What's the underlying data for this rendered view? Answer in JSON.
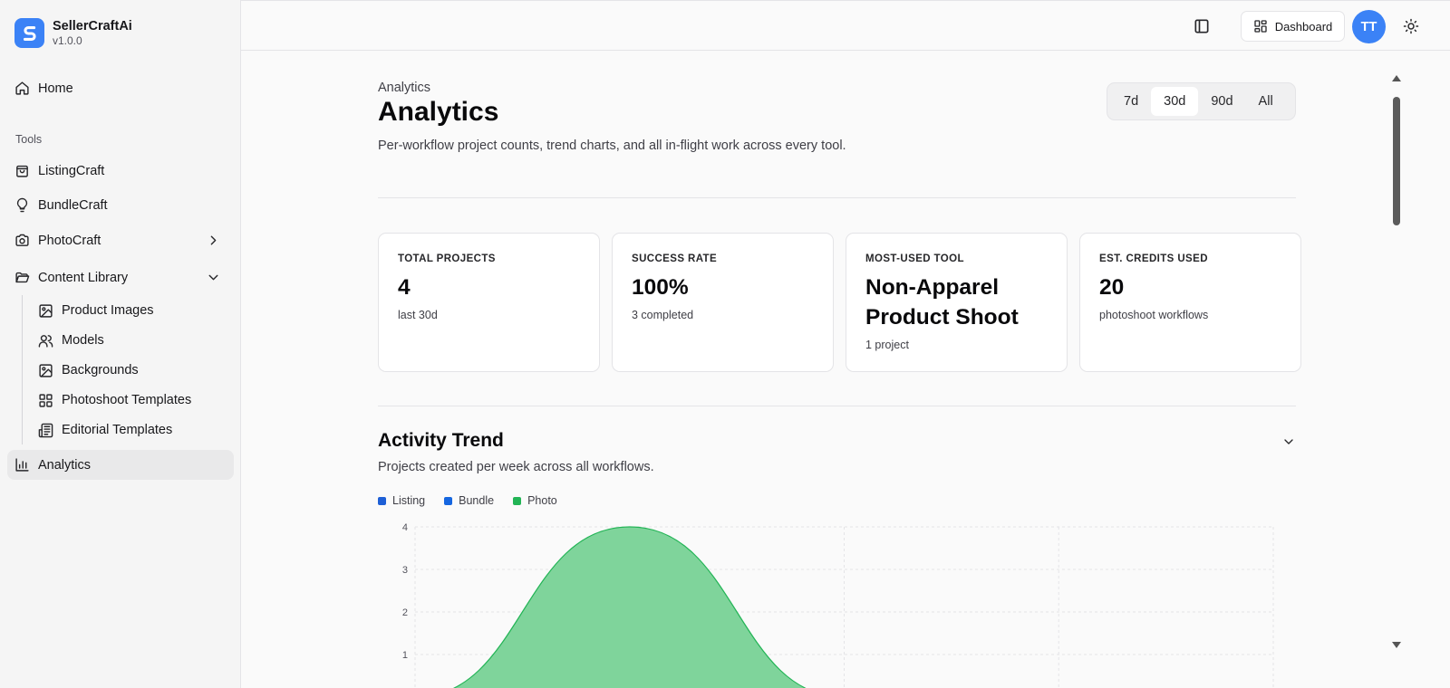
{
  "brand": {
    "name": "SellerCraftAi",
    "version": "v1.0.0"
  },
  "nav": {
    "home": "Home",
    "tools_label": "Tools",
    "listingcraft": "ListingCraft",
    "bundlecraft": "BundleCraft",
    "photocraft": "PhotoCraft",
    "content_library": "Content Library",
    "library_items": [
      "Product Images",
      "Models",
      "Backgrounds",
      "Photoshoot Templates",
      "Editorial Templates"
    ],
    "analytics": "Analytics"
  },
  "topbar": {
    "dashboard_label": "Dashboard",
    "avatar_initials": "TT"
  },
  "page": {
    "breadcrumb": "Analytics",
    "title": "Analytics",
    "description": "Per-workflow project counts, trend charts, and all in-flight work across every tool."
  },
  "range": {
    "options": [
      "7d",
      "30d",
      "90d",
      "All"
    ],
    "selected": "30d"
  },
  "cards": [
    {
      "label": "TOTAL PROJECTS",
      "value": "4",
      "sub": "last 30d"
    },
    {
      "label": "SUCCESS RATE",
      "value": "100%",
      "sub": "3 completed"
    },
    {
      "label": "MOST-USED TOOL",
      "value": "Non-Apparel Product Shoot",
      "sub": "1 project"
    },
    {
      "label": "EST. CREDITS USED",
      "value": "20",
      "sub": "photoshoot workflows"
    }
  ],
  "activity": {
    "title": "Activity Trend",
    "description": "Projects created per week across all workflows."
  },
  "colors": {
    "accent": "#3b82f6",
    "listing": "#1d5fd6",
    "bundle": "#1566e0",
    "photo": "#22b455",
    "photo_fill": "#7fd49b"
  },
  "chart_data": {
    "type": "area",
    "series": [
      {
        "name": "Listing",
        "values": [
          0,
          0,
          0,
          0,
          0
        ]
      },
      {
        "name": "Bundle",
        "values": [
          0,
          0,
          0,
          0,
          0
        ]
      },
      {
        "name": "Photo",
        "values": [
          0,
          4,
          0,
          0,
          0
        ]
      }
    ],
    "yticks": [
      1,
      2,
      3,
      4
    ],
    "ylim": [
      0,
      4
    ],
    "grid": true,
    "legend": "top-left"
  }
}
